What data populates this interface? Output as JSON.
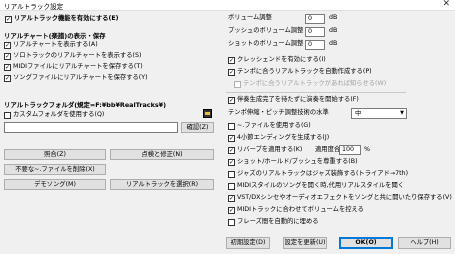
{
  "window": {
    "title": "リアルトラック設定",
    "close_glyph": "✕"
  },
  "left": {
    "enable": "リアルトラック機能を有効にする(E)",
    "section1": "リアルチャート(楽譜)の表示・保存",
    "show_chart": "リアルチャートを表示する(A)",
    "show_solo": "ソロトラックのリアルチャートを表示する(S)",
    "save_midi": "MIDIファイルにリアルチャートを保存する(T)",
    "save_song": "ソングファイルにリアルチャートを保存する(Y)",
    "section2": "リアルトラックフォルダ(規定=F:¥bb¥RealTracks¥)",
    "custom_folder": "カスタムフォルダを使用する(Q)",
    "folder_value": "",
    "confirm_button": "確認(Z)",
    "btn_query": "照合(Z)",
    "btn_check_fix": "点検と修正(N)",
    "btn_delete": "不要な~.ファイルを削除(X)",
    "btn_demo": "デモソング(M)",
    "btn_select": "リアルトラックを選択(R)"
  },
  "right": {
    "volume_label": "ボリューム調整",
    "volume_value": "0",
    "push_volume_label": "プッシュのボリューム調整",
    "push_volume_value": "0",
    "shot_volume_label": "ショットのボリューム調整",
    "shot_volume_value": "0",
    "unit_db": "dB",
    "crescendo": "クレッシェンドを有効にする(I)",
    "tempo_auto": "テンポに合うリアルトラックを自動作成する(P)",
    "tempo_sub": "テンポに合うリアルトラックがあれば知らせる(W)",
    "wait_gen": "伴奏生成完了を待たずに演奏を開始する(F)",
    "tempo_stretch_label": "テンポ伸縮・ピッチ調整技術の水準",
    "tempo_stretch_value": "中",
    "use_wav": "~.ファイルを使用する(G)",
    "four_bar": "4小節エンディングを生成する(J)",
    "reverb": "リバーブを適用する(K)",
    "reverb_amount_label": "適用度合",
    "reverb_amount_value": "100",
    "reverb_unit": "%",
    "shot_hold": "ショット/ホールド/プッシュを尊重する(B)",
    "jazz_chords": "ジャズのリアルトラックはジャズ装飾する(トライアド→7th)",
    "midi_style": "MIDIスタイルのソングを開く時,代用リアルスタイルを聞く",
    "vst_dx": "VST/DXシンセやオーディオエフェクトをソングと共に開いたり保存する(V)",
    "midi_tracks": "MIDIトラックに合わせてボリュームを控える",
    "phrase": "フレーズ間を自動的に埋める"
  },
  "footer": {
    "defaults": "初期設定(D)",
    "update": "設定を更新(U)",
    "ok": "OK(O)",
    "help": "ヘルプ(H)"
  },
  "colors": {
    "accent": "#0078d7",
    "background": "#f0f0f0"
  }
}
